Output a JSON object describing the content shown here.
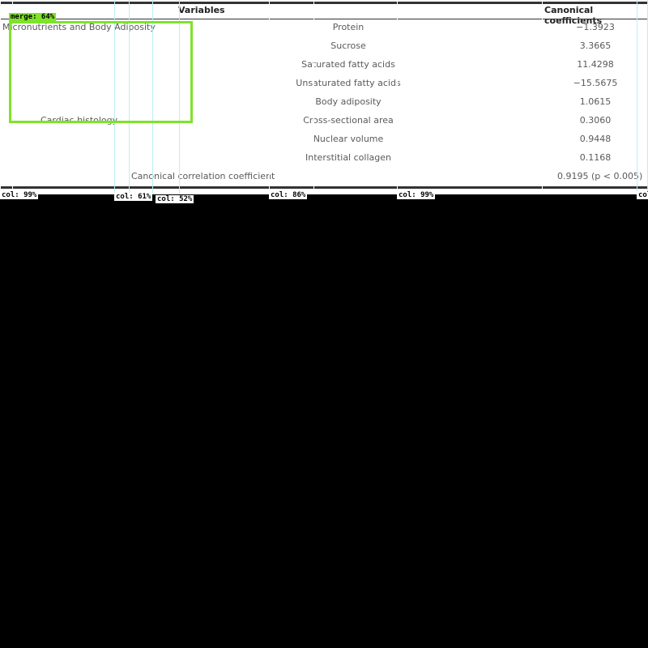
{
  "table": {
    "header": {
      "variables": "Variables",
      "coefficients": "Canonical coefficients"
    },
    "groups": [
      {
        "label": "Micronutrients and Body Adiposity"
      },
      {
        "label": "Cardiac histology"
      }
    ],
    "rows": [
      {
        "variable": "Protein",
        "coefficient": "−1.3923"
      },
      {
        "variable": "Sucrose",
        "coefficient": "3.3665"
      },
      {
        "variable": "Saturated fatty acids",
        "coefficient": "11.4298"
      },
      {
        "variable": "Unsaturated fatty acids",
        "coefficient": "−15.5675"
      },
      {
        "variable": "Body adiposity",
        "coefficient": "1.0615"
      },
      {
        "variable": "Cross-sectional area",
        "coefficient": "0.3060"
      },
      {
        "variable": "Nuclear volume",
        "coefficient": "0.9448"
      },
      {
        "variable": "Interstitial collagen",
        "coefficient": "0.1168"
      }
    ],
    "footer": {
      "label": "Canonical correlation coefficient",
      "value": "0.9195 (p < 0.005)"
    }
  },
  "overlay": {
    "merge_label": "merge: 64%",
    "column_labels": [
      "col: 99%",
      "col: 61%",
      "col: 52%",
      "col: 86%",
      "col: 99%",
      "col"
    ]
  },
  "colors": {
    "merge_box": "#7ee32a",
    "column_box": "#bfeef4",
    "background": "#000000"
  }
}
